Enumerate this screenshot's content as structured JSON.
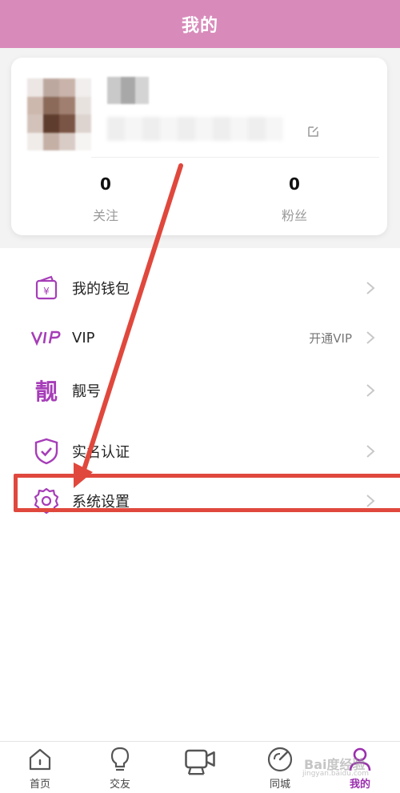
{
  "header": {
    "title": "我的"
  },
  "profile": {
    "stats": [
      {
        "value": "0",
        "label": "关注"
      },
      {
        "value": "0",
        "label": "粉丝"
      }
    ]
  },
  "menu": {
    "items": [
      {
        "label": "我的钱包",
        "extra": "",
        "icon": "wallet-icon"
      },
      {
        "label": "VIP",
        "extra": "开通VIP",
        "icon": "vip-icon"
      },
      {
        "label": "靓号",
        "extra": "",
        "icon": "pretty-number-icon",
        "icon_text": "靓"
      },
      {
        "label": "实名认证",
        "extra": "",
        "icon": "shield-check-icon"
      },
      {
        "label": "系统设置",
        "extra": "",
        "icon": "gear-icon"
      }
    ]
  },
  "tabbar": {
    "tabs": [
      {
        "label": "首页",
        "icon": "home-icon",
        "active": false
      },
      {
        "label": "交友",
        "icon": "lightbulb-icon",
        "active": false
      },
      {
        "label": "",
        "icon": "video-camera-icon",
        "active": false
      },
      {
        "label": "同城",
        "icon": "radar-icon",
        "active": false
      },
      {
        "label": "我的",
        "icon": "person-icon",
        "active": true
      }
    ]
  },
  "watermark": {
    "text": "Bai度经验",
    "sub": "jingyan.baidu.com"
  },
  "colors": {
    "header": "#d88bbb",
    "accent": "#9b2fae",
    "annotation": "#e0483d"
  }
}
